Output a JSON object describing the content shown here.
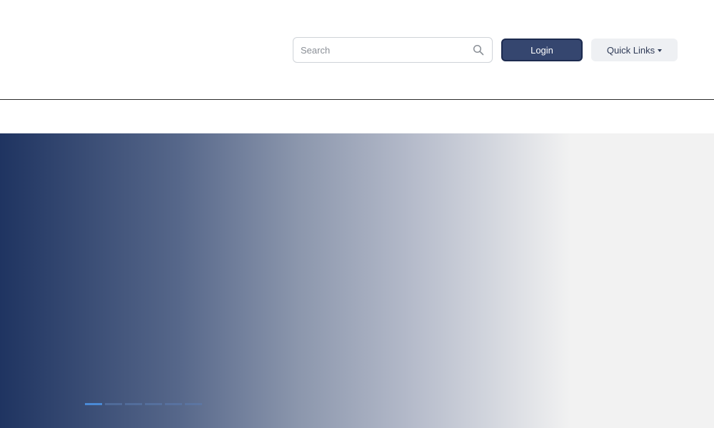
{
  "header": {
    "search": {
      "placeholder": "Search",
      "value": "",
      "icon": "search-icon"
    },
    "login_label": "Login",
    "quick_links": {
      "label": "Quick Links",
      "icon": "caret-down-icon"
    }
  },
  "hero": {
    "gradient_colors": [
      "#1f3461",
      "#f2f2f2"
    ],
    "carousel": {
      "slide_count": 6,
      "active_index": 0
    }
  },
  "colors": {
    "primary": "#35466f",
    "primary_border": "#1c2a4f",
    "quick_links_bg": "#eef0f3",
    "indicator_active": "#4a8ad6",
    "indicator": "#5b7cb0"
  }
}
